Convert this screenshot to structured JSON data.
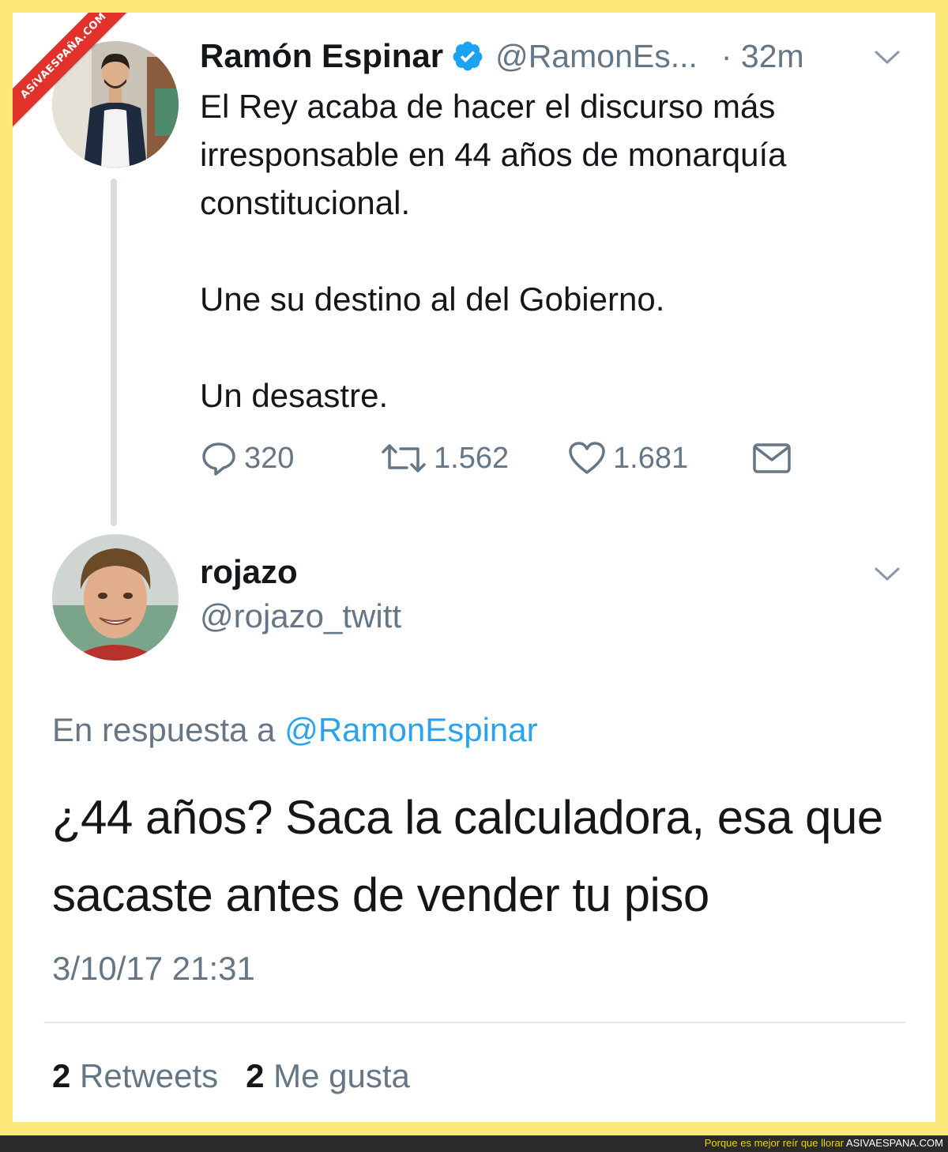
{
  "watermark": "ASíVAESPAÑA.COM",
  "tweet": {
    "author_name": "Ramón Espinar",
    "author_handle": "@RamonEs...",
    "time": "· 32m",
    "text": {
      "p1": "El Rey acaba de hacer el discurso más irresponsable en 44 años de monarquía constitucional.",
      "p2": "Une su destino al del Gobierno.",
      "p3": "Un desastre."
    },
    "replies": "320",
    "retweets": "1.562",
    "likes": "1.681"
  },
  "reply": {
    "author_name": "rojazo",
    "author_handle": "@rojazo_twitt",
    "in_reply_prefix": "En respuesta a",
    "in_reply_handle": "@RamonEspinar",
    "text": "¿44 años? Saca la calculadora, esa que sacaste antes de vender tu piso",
    "timestamp": "3/10/17 21:31",
    "retweet_count": "2",
    "retweet_label": "Retweets",
    "like_count": "2",
    "like_label": "Me gusta"
  },
  "footer": {
    "tagline": "Porque es mejor reír que llorar",
    "site": "ASIVAESPANA.COM"
  },
  "colors": {
    "frame": "#fde97a",
    "link": "#2aa3ef",
    "muted": "#657786",
    "verified": "#1da1f2",
    "banner": "#e0312b"
  },
  "icons": [
    "verified-icon",
    "chevron-down-icon",
    "reply-icon",
    "retweet-icon",
    "heart-icon",
    "envelope-icon"
  ]
}
